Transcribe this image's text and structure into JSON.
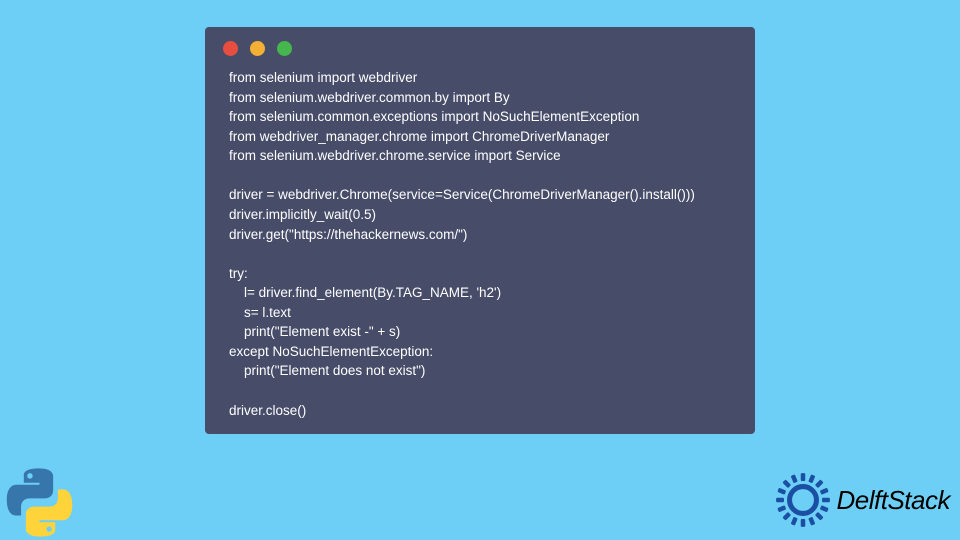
{
  "code": {
    "line1": "from selenium import webdriver",
    "line2": "from selenium.webdriver.common.by import By",
    "line3": "from selenium.common.exceptions import NoSuchElementException",
    "line4": "from webdriver_manager.chrome import ChromeDriverManager",
    "line5": "from selenium.webdriver.chrome.service import Service",
    "line6": "",
    "line7": "driver = webdriver.Chrome(service=Service(ChromeDriverManager().install()))",
    "line8": "driver.implicitly_wait(0.5)",
    "line9": "driver.get(\"https://thehackernews.com/\")",
    "line10": "",
    "line11": "try:",
    "line12": "    l= driver.find_element(By.TAG_NAME, 'h2')",
    "line13": "    s= l.text",
    "line14": "    print(\"Element exist -\" + s)",
    "line15": "except NoSuchElementException:",
    "line16": "    print(\"Element does not exist\")",
    "line17": "",
    "line18": "driver.close()"
  },
  "brand": {
    "name": "DelftStack"
  }
}
